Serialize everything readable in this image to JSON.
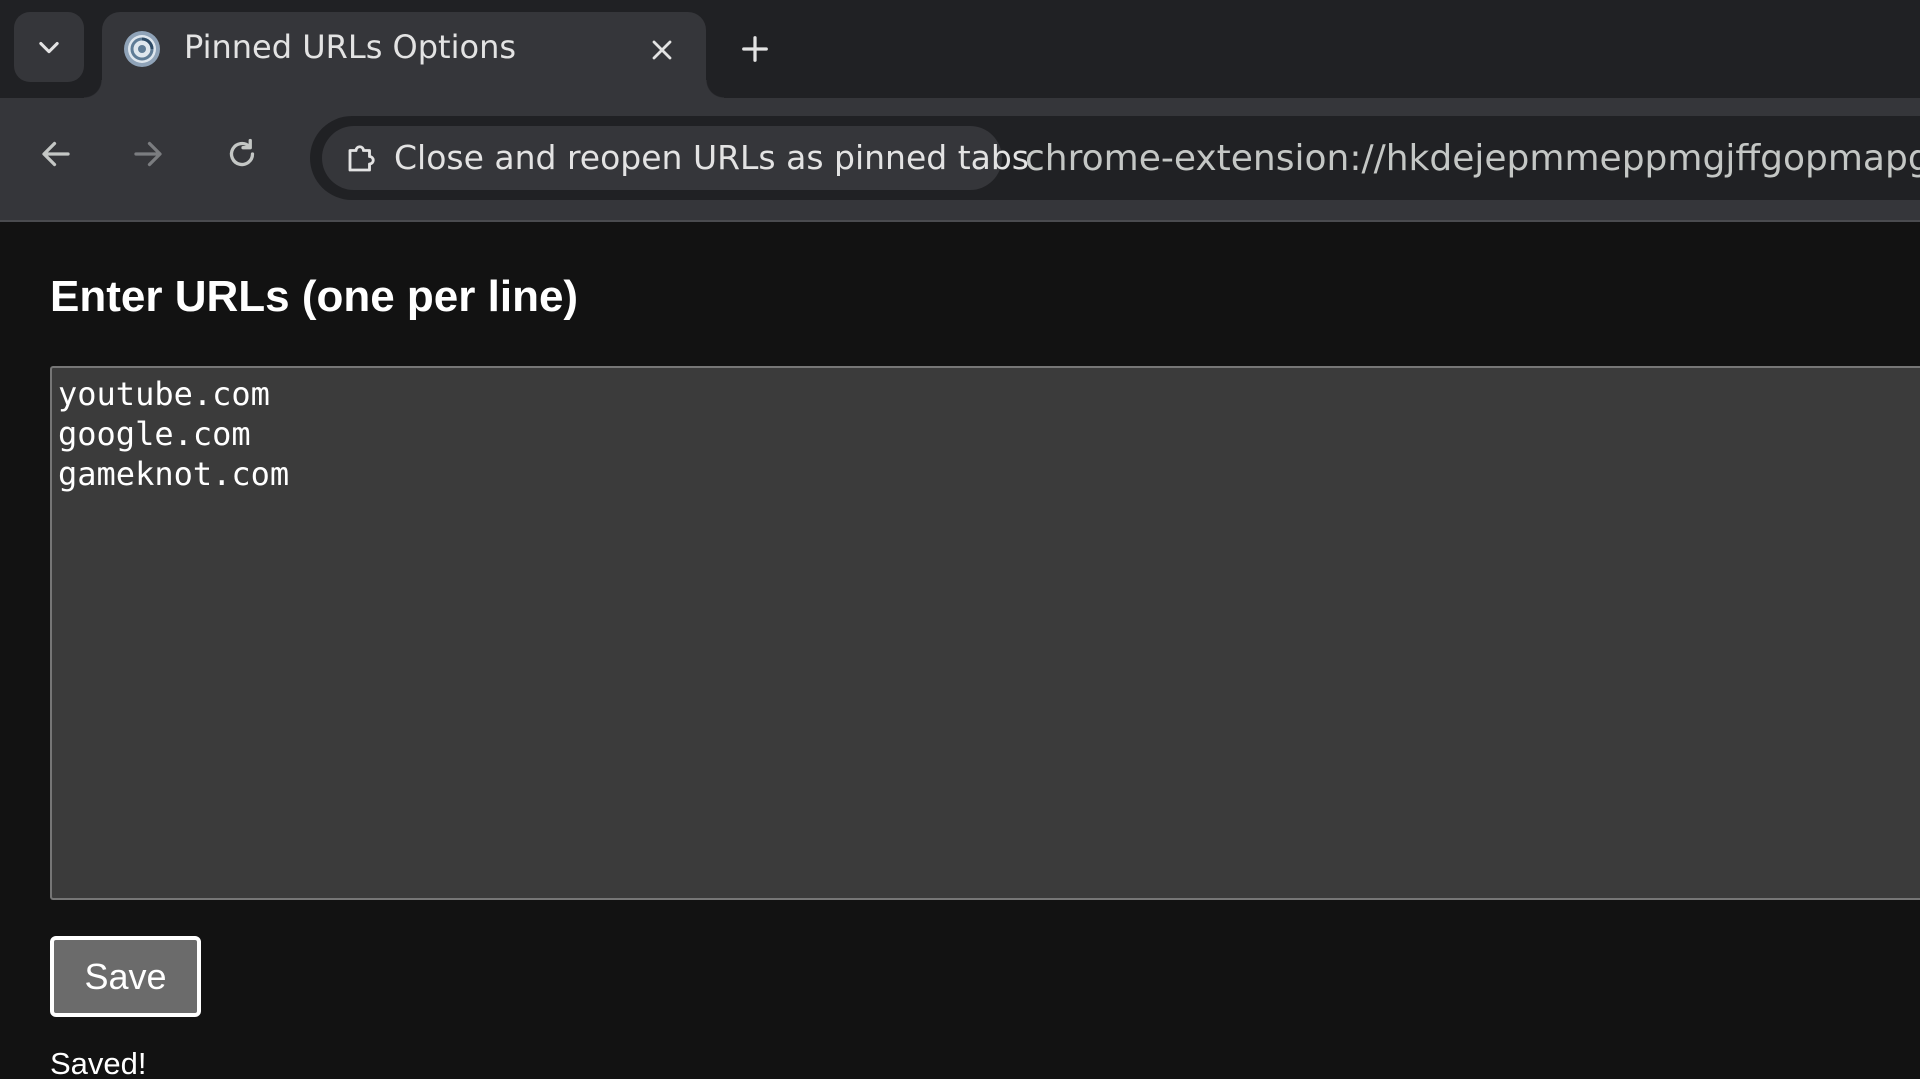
{
  "browser": {
    "tab": {
      "title": "Pinned URLs Options",
      "favicon": "extension-page-icon"
    },
    "toolbar": {
      "extension_name": "Close and reopen URLs as pinned tabs",
      "url": "chrome-extension://hkdejepmmeppmgjffgopmapgi"
    },
    "icons": {
      "tab_search": "chevron-down-icon",
      "tab_close": "close-icon",
      "new_tab": "plus-icon",
      "back": "arrow-left-icon",
      "forward": "arrow-right-icon",
      "reload": "reload-icon",
      "extension": "puzzle-icon"
    }
  },
  "page": {
    "heading": "Enter URLs (one per line)",
    "textarea_value": "youtube.com\ngoogle.com\ngameknot.com",
    "save_label": "Save",
    "status": "Saved!"
  },
  "colors": {
    "tabstrip_bg": "#202124",
    "toolbar_bg": "#35363a",
    "page_bg": "#121212",
    "textarea_bg": "#3b3b3b",
    "button_bg": "#6b6b6b"
  }
}
